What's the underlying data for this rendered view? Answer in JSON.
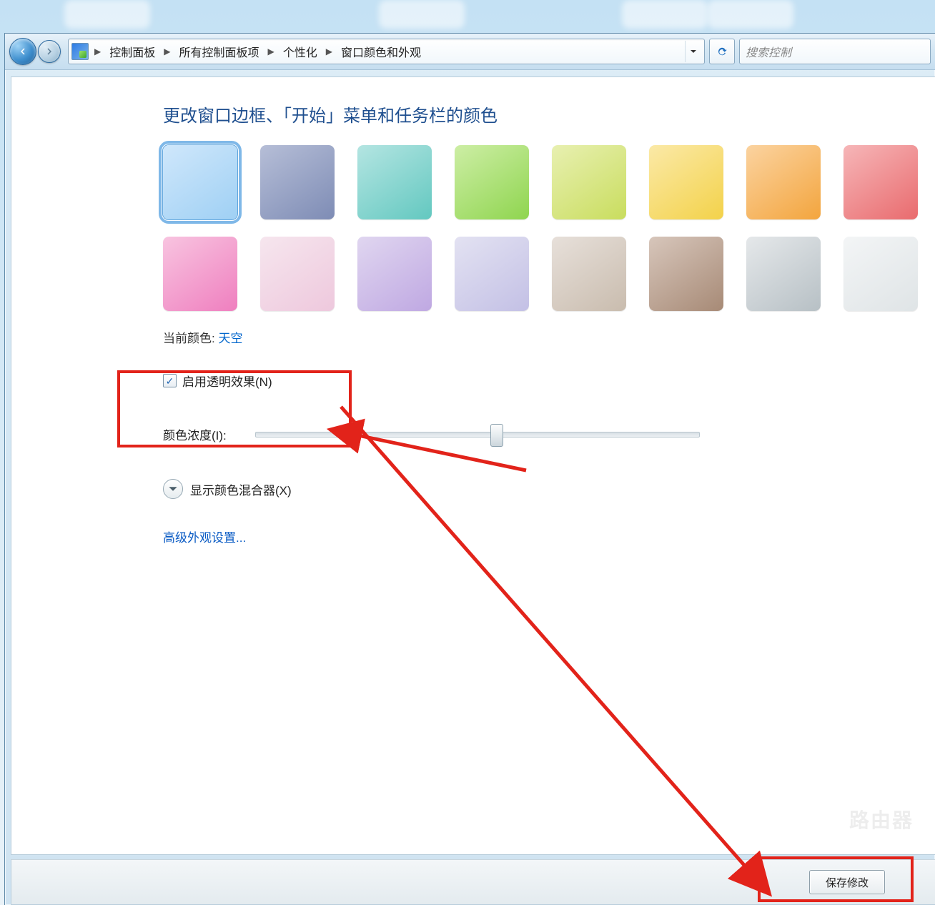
{
  "breadcrumb": {
    "items": [
      "控制面板",
      "所有控制面板项",
      "个性化",
      "窗口颜色和外观"
    ]
  },
  "search": {
    "placeholder": "搜索控制"
  },
  "page": {
    "title": "更改窗口边框、「开始」菜单和任务栏的颜色",
    "current_color_label": "当前颜色:",
    "current_color_value": "天空",
    "transparency_label": "启用透明效果(N)",
    "transparency_checked": true,
    "intensity_label": "颜色浓度(I):",
    "mixer_label": "显示颜色混合器(X)",
    "advanced_link": "高级外观设置...",
    "save_button": "保存修改"
  },
  "swatches": [
    {
      "name": "sky",
      "color1": "#cfe7fb",
      "color2": "#9fd0f4",
      "selected": true
    },
    {
      "name": "twilight",
      "color1": "#b6bed7",
      "color2": "#7e8cb5"
    },
    {
      "name": "sea",
      "color1": "#b4e5e2",
      "color2": "#63c8c0"
    },
    {
      "name": "leaf",
      "color1": "#cdeea5",
      "color2": "#8fd54f"
    },
    {
      "name": "lime",
      "color1": "#e8f0b1",
      "color2": "#c9dd5e"
    },
    {
      "name": "sun",
      "color1": "#fbe9a7",
      "color2": "#f3d24a"
    },
    {
      "name": "pumpkin",
      "color1": "#fbd3a0",
      "color2": "#f3a53e"
    },
    {
      "name": "ruby",
      "color1": "#f6b6b8",
      "color2": "#e96b6e"
    },
    {
      "name": "fuchsia",
      "color1": "#f8c4e0",
      "color2": "#ef7fbf"
    },
    {
      "name": "blush",
      "color1": "#f6e6ee",
      "color2": "#eec8dd"
    },
    {
      "name": "violet",
      "color1": "#e0d6f0",
      "color2": "#bfa8e2"
    },
    {
      "name": "lavender",
      "color1": "#e3e2f2",
      "color2": "#c3c0e5"
    },
    {
      "name": "taupe",
      "color1": "#e7e0da",
      "color2": "#c9bcae"
    },
    {
      "name": "chocolate",
      "color1": "#d7c6bb",
      "color2": "#a78a76"
    },
    {
      "name": "slate",
      "color1": "#e5e8ea",
      "color2": "#b7c0c5"
    },
    {
      "name": "frost",
      "color1": "#f3f5f6",
      "color2": "#dfe4e6"
    }
  ]
}
